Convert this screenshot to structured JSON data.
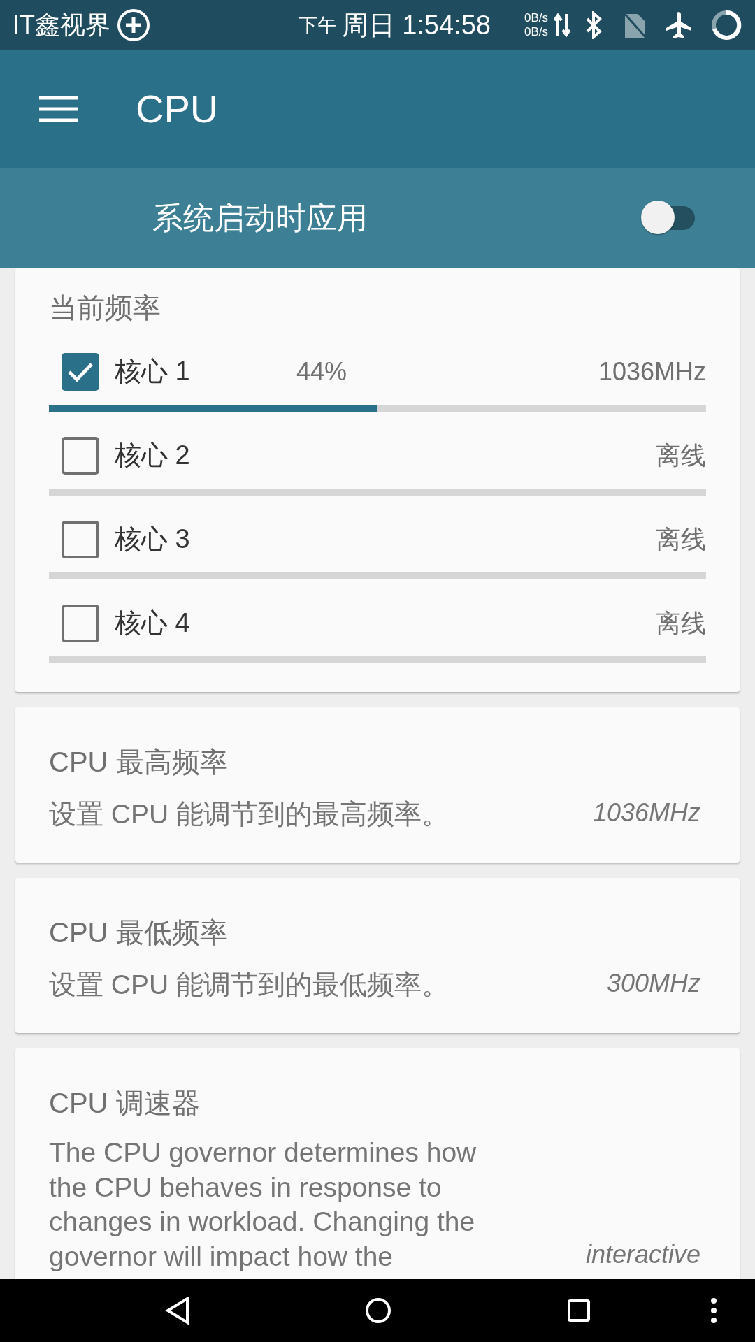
{
  "status_bar": {
    "carrier": "IT鑫视界",
    "ampm": "下午",
    "time": "周日 1:54:58",
    "net_up": "0B/s",
    "net_down": "0B/s"
  },
  "app_bar": {
    "title": "CPU"
  },
  "boot_toggle": {
    "label": "系统启动时应用",
    "on": false
  },
  "frequency_card": {
    "title": "当前频率",
    "cores": [
      {
        "label": "核心 1",
        "checked": true,
        "percent": "44%",
        "reading": "1036MHz",
        "level": 0.5
      },
      {
        "label": "核心 2",
        "checked": false,
        "reading": "离线"
      },
      {
        "label": "核心 3",
        "checked": false,
        "reading": "离线"
      },
      {
        "label": "核心 4",
        "checked": false,
        "reading": "离线"
      }
    ]
  },
  "settings": [
    {
      "title": "CPU 最高频率",
      "description": "设置 CPU 能调节到的最高频率。",
      "value": "1036MHz"
    },
    {
      "title": "CPU 最低频率",
      "description": "设置 CPU 能调节到的最低频率。",
      "value": "300MHz"
    },
    {
      "title": "CPU 调速器",
      "description": "The CPU governor determines how the CPU behaves in response to changes in workload. Changing the governor will impact how the",
      "value": "interactive"
    }
  ]
}
